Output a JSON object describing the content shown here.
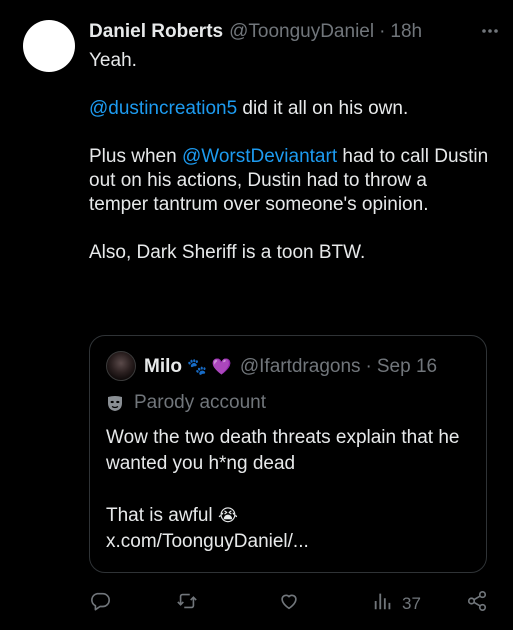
{
  "tweet": {
    "author_name": "Daniel Roberts",
    "author_handle": "@ToonguyDaniel",
    "separator": "·",
    "time": "18h",
    "body": {
      "line1": "Yeah.",
      "p2_mention": "@dustincreation5",
      "p2_text": " did it all on his own.",
      "p3_prefix": "Plus when ",
      "p3_mention": "@WorstDeviantart",
      "p3_text": " had to call Dustin out on his actions, Dustin had to throw a temper tantrum over someone's opinion.",
      "p4": "Also, Dark Sheriff is a toon BTW."
    },
    "views": "37"
  },
  "quote": {
    "author_name": "Milo",
    "emoji_paw": "🐾",
    "emoji_heart": "💜",
    "author_handle": "@Ifartdragons",
    "separator": "·",
    "time": "Sep 16",
    "label": "Parody account",
    "body_p1": "Wow the two death threats explain that he wanted you h*ng dead",
    "body_p2_text": "That is awful ",
    "body_p2_emoji": "😭",
    "link": "x.com/ToonguyDaniel/..."
  },
  "icons": {
    "more": "more-icon",
    "reply": "reply-icon",
    "retweet": "retweet-icon",
    "like": "like-icon",
    "views": "views-icon",
    "share": "share-icon",
    "parody": "parody-mask-icon"
  },
  "colors": {
    "background": "#000000",
    "text": "#e7e9ea",
    "muted": "#71767b",
    "link": "#1d9bf0",
    "border": "#2f3336"
  }
}
